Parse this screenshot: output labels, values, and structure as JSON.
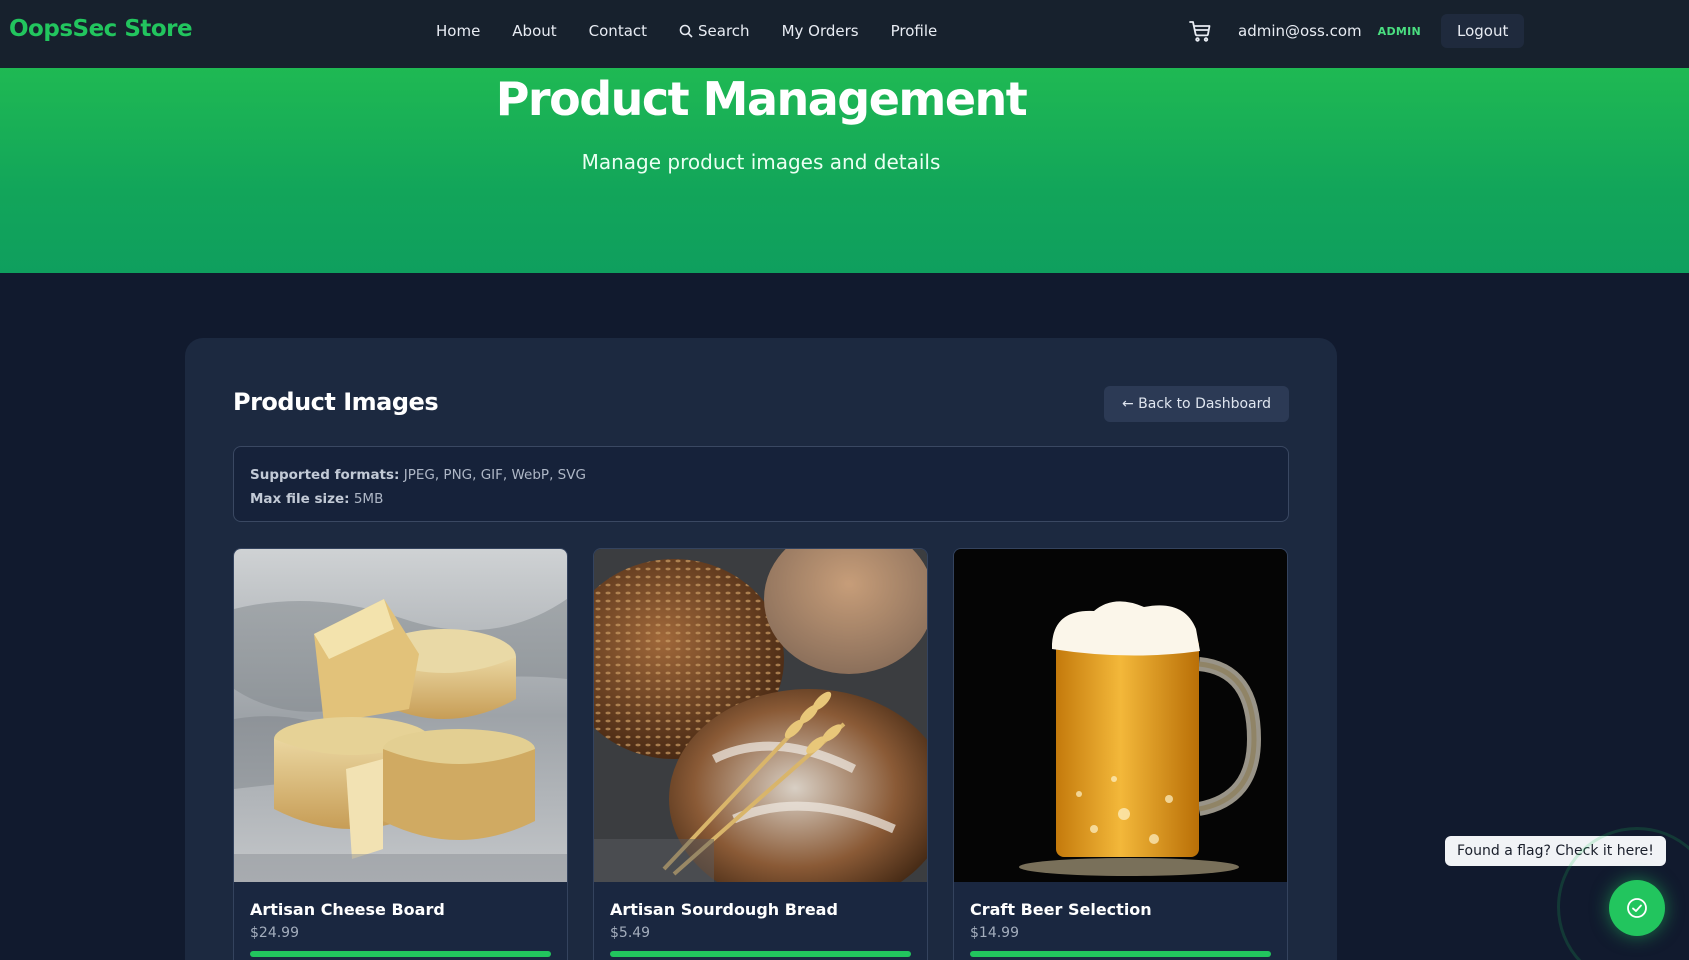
{
  "navbar": {
    "brand": "OopsSec Store",
    "links": [
      "Home",
      "About",
      "Contact",
      "Search",
      "My Orders",
      "Profile"
    ],
    "cart_icon": "cart-icon",
    "user_email": "admin@oss.com",
    "role_badge": "ADMIN",
    "logout_label": "Logout"
  },
  "hero": {
    "title": "Product Management",
    "subtitle": "Manage product images and details"
  },
  "panel": {
    "title": "Product Images",
    "back_label": "← Back to Dashboard",
    "info": {
      "formats_label": "Supported formats:",
      "formats_value": "JPEG, PNG, GIF, WebP, SVG",
      "size_label": "Max file size:",
      "size_value": "5MB"
    },
    "products": [
      {
        "name": "Artisan Cheese Board",
        "price": "$24.99",
        "image": "cheese-wheels-photo"
      },
      {
        "name": "Artisan Sourdough Bread",
        "price": "$5.49",
        "image": "bread-loaves-photo"
      },
      {
        "name": "Craft Beer Selection",
        "price": "$14.99",
        "image": "beer-mug-photo"
      }
    ]
  },
  "flag_widget": {
    "tooltip": "Found a flag? Check it here!",
    "icon": "check-circle-icon"
  },
  "colors": {
    "accent": "#22c55e",
    "background": "#111a2e",
    "panel": "#1c2940"
  }
}
